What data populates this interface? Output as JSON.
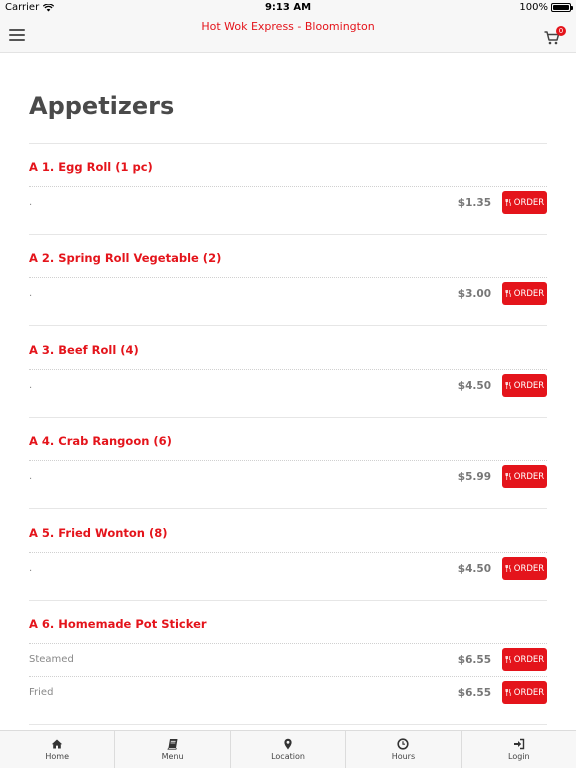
{
  "status_bar": {
    "carrier": "Carrier",
    "time": "9:13 AM",
    "battery": "100%"
  },
  "header": {
    "title": "Hot Wok Express - Bloomington",
    "cart_count": "0"
  },
  "page": {
    "title": "Appetizers"
  },
  "items": [
    {
      "name": "A 1. Egg Roll (1 pc)",
      "options": [
        {
          "label": ".",
          "price": "$1.35",
          "button": "ORDER"
        }
      ]
    },
    {
      "name": "A 2. Spring Roll Vegetable (2)",
      "options": [
        {
          "label": ".",
          "price": "$3.00",
          "button": "ORDER"
        }
      ]
    },
    {
      "name": "A 3. Beef Roll (4)",
      "options": [
        {
          "label": ".",
          "price": "$4.50",
          "button": "ORDER"
        }
      ]
    },
    {
      "name": "A 4. Crab Rangoon (6)",
      "options": [
        {
          "label": ".",
          "price": "$5.99",
          "button": "ORDER"
        }
      ]
    },
    {
      "name": "A 5. Fried Wonton (8)",
      "options": [
        {
          "label": ".",
          "price": "$4.50",
          "button": "ORDER"
        }
      ]
    },
    {
      "name": "A 6. Homemade Pot Sticker",
      "options": [
        {
          "label": "Steamed",
          "price": "$6.55",
          "button": "ORDER"
        },
        {
          "label": "Fried",
          "price": "$6.55",
          "button": "ORDER"
        }
      ]
    }
  ],
  "tabs": [
    {
      "label": "Home",
      "icon": "home-icon"
    },
    {
      "label": "Menu",
      "icon": "book-icon"
    },
    {
      "label": "Location",
      "icon": "map-pin-icon"
    },
    {
      "label": "Hours",
      "icon": "clock-icon"
    },
    {
      "label": "Login",
      "icon": "login-icon"
    }
  ],
  "colors": {
    "accent": "#e4141b",
    "bar_background": "#f7f7f7"
  }
}
